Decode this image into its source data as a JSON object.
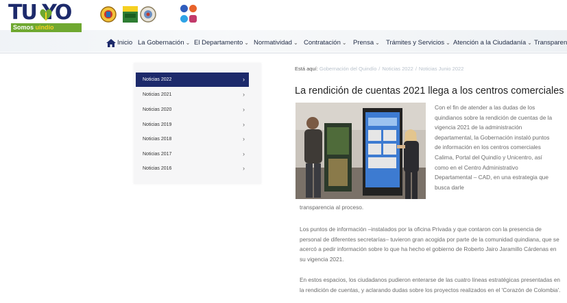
{
  "logo": {
    "main": "TU  YO",
    "sub_left": "Somos ",
    "sub_right": "uindío"
  },
  "nav": {
    "items": [
      {
        "label": "Inicio",
        "chevron": ""
      },
      {
        "label": "La Gobernación",
        "chevron": "⌄"
      },
      {
        "label": "El Departamento",
        "chevron": "⌄"
      },
      {
        "label": "Normatividad",
        "chevron": "⌄"
      },
      {
        "label": "Contratación",
        "chevron": "⌄"
      },
      {
        "label": "Prensa",
        "chevron": "⌄"
      },
      {
        "label": "Trámites y Servicios",
        "chevron": "⌄"
      },
      {
        "label": "Atención a la Ciudadanía",
        "chevron": "⌄"
      },
      {
        "label": "Transparenc",
        "chevron": ""
      }
    ]
  },
  "sidebar": {
    "items": [
      {
        "label": "Noticias 2022",
        "arrow": "›"
      },
      {
        "label": "Noticias 2021",
        "arrow": "›"
      },
      {
        "label": "Noticias 2020",
        "arrow": "›"
      },
      {
        "label": "Noticias 2019",
        "arrow": "›"
      },
      {
        "label": "Noticias 2018",
        "arrow": "›"
      },
      {
        "label": "Noticias 2017",
        "arrow": "›"
      },
      {
        "label": "Noticias 2016",
        "arrow": "›"
      }
    ]
  },
  "breadcrumb": {
    "here": "Está aquí:",
    "items": [
      "Gobernación del Quindío",
      "Noticias 2022",
      "Noticias Junio 2022"
    ],
    "sep": "/"
  },
  "article": {
    "title": "La rendición de cuentas 2021 llega a los centros comerciales",
    "p1": "Con el fin de atender a las dudas de los quindianos sobre la rendición de cuentas de la vigencia 2021 de la administración departamental, la Gobernación instaló puntos de información en los centros comerciales Calima, Portal del Quindío y Unicentro, así como en el Centro Administrativo Departamental – CAD, en una estrategia que busca darle",
    "p1_end": "transparencia al proceso.",
    "p2": "Los puntos de información –instalados por la oficina Privada y que contaron con la presencia de personal de diferentes secretarías– tuvieron gran acogida por parte de la comunidad quindiana, que se acercó a pedir información sobre lo que ha hecho el gobierno de Roberto Jairo Jaramillo Cárdenas en su vigencia 2021.",
    "p3": "En estos espacios, los ciudadanos pudieron enterarse de las cuatro líneas estratégicas presentadas en la rendición de cuentas, y aclarando dudas sobre los proyectos realizados en el 'Corazón de Colombia'."
  },
  "colors": {
    "navy": "#1d2a6b",
    "green": "#6fa830",
    "yellow": "#f6d021"
  }
}
